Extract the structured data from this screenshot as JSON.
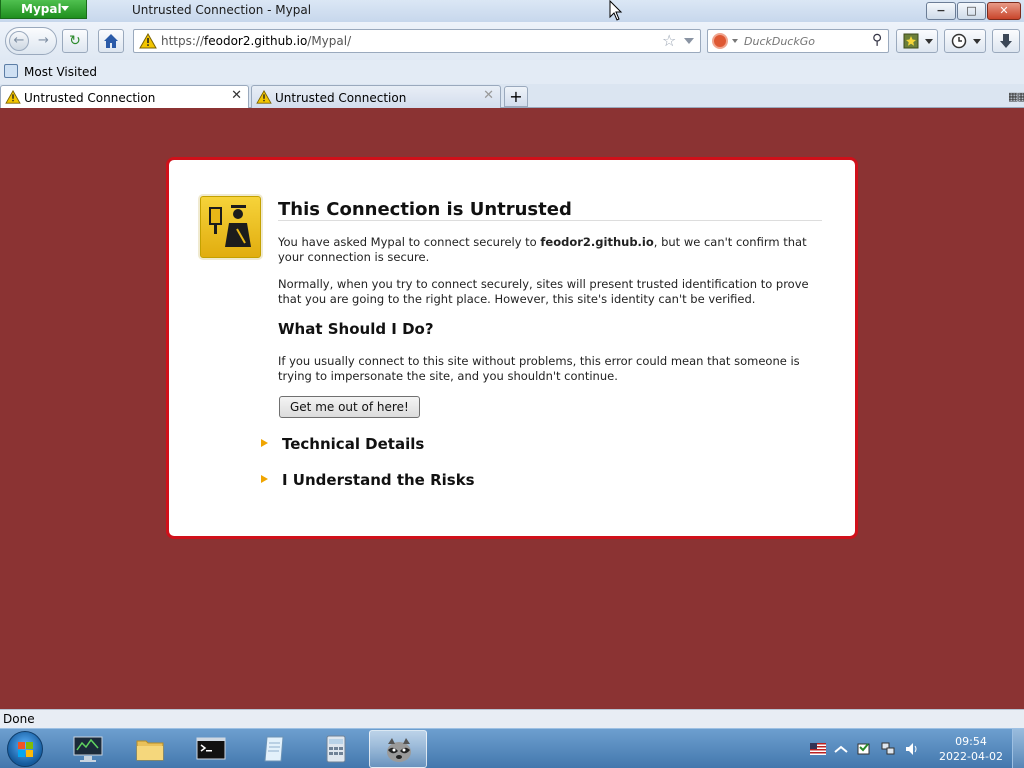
{
  "app_menu": {
    "label": "Mypal"
  },
  "window": {
    "title": "Untrusted Connection - Mypal",
    "minimize": "−",
    "maximize": "□",
    "close": "✕"
  },
  "nav": {
    "url_prefix": "https://",
    "url_host": "feodor2.github.io",
    "url_path": "/Mypal/",
    "search_placeholder": "DuckDuckGo"
  },
  "bookmarks": {
    "items": [
      {
        "label": "Most Visited"
      }
    ]
  },
  "tabs": [
    {
      "label": "Untrusted Connection",
      "active": true
    },
    {
      "label": "Untrusted Connection",
      "active": false
    }
  ],
  "page": {
    "title": "This Connection is Untrusted",
    "intro_before": "You have asked Mypal to connect securely to ",
    "intro_host": "feodor2.github.io",
    "intro_after": ", but we can't confirm that your connection is secure.",
    "normally": "Normally, when you try to connect securely, sites will present trusted identification to prove that you are going to the right place. However, this site's identity can't be verified.",
    "what_heading": "What Should I Do?",
    "what_text": "If you usually connect to this site without problems, this error could mean that someone is trying to impersonate the site, and you shouldn't continue.",
    "get_out_button": "Get me out of here!",
    "technical_details": "Technical Details",
    "understand_risks": "I Understand the Risks"
  },
  "status": {
    "text": "Done"
  },
  "taskbar": {
    "items": [
      {
        "icon": "performance-monitor-icon"
      },
      {
        "icon": "folder-icon"
      },
      {
        "icon": "command-prompt-icon"
      },
      {
        "icon": "notepad-icon"
      },
      {
        "icon": "calculator-icon"
      },
      {
        "icon": "mypal-raccoon-icon",
        "active": true
      }
    ],
    "clock_time": "09:54",
    "clock_date": "2022-04-02"
  },
  "colors": {
    "page_background": "#8b3333",
    "error_border": "#d0101a",
    "app_menu_green": "#1e8f1e",
    "expander_arrow": "#f0a500"
  }
}
